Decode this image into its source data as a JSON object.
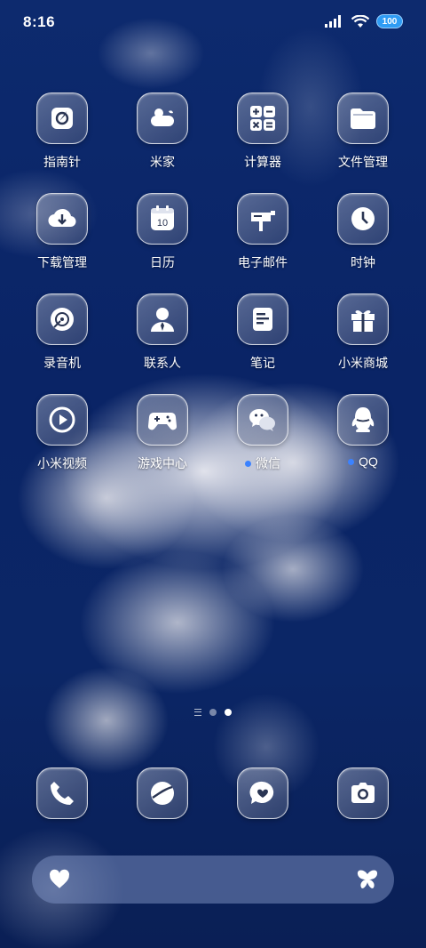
{
  "status": {
    "time": "8:16",
    "battery": "100"
  },
  "apps": [
    {
      "name": "指南针",
      "icon": "compass-icon",
      "dot": false
    },
    {
      "name": "米家",
      "icon": "mijia-icon",
      "dot": false
    },
    {
      "name": "计算器",
      "icon": "calculator-icon",
      "dot": false
    },
    {
      "name": "文件管理",
      "icon": "folder-icon",
      "dot": false
    },
    {
      "name": "下载管理",
      "icon": "download-icon",
      "dot": false
    },
    {
      "name": "日历",
      "icon": "calendar-icon",
      "dot": false,
      "badge": "10"
    },
    {
      "name": "电子邮件",
      "icon": "mailbox-icon",
      "dot": false
    },
    {
      "name": "时钟",
      "icon": "clock-icon",
      "dot": false
    },
    {
      "name": "录音机",
      "icon": "recorder-icon",
      "dot": false
    },
    {
      "name": "联系人",
      "icon": "contacts-icon",
      "dot": false
    },
    {
      "name": "笔记",
      "icon": "notes-icon",
      "dot": false
    },
    {
      "name": "小米商城",
      "icon": "gift-icon",
      "dot": false
    },
    {
      "name": "小米视频",
      "icon": "play-icon",
      "dot": false
    },
    {
      "name": "游戏中心",
      "icon": "gamepad-icon",
      "dot": false
    },
    {
      "name": "微信",
      "icon": "wechat-icon",
      "dot": true
    },
    {
      "name": "QQ",
      "icon": "qq-icon",
      "dot": true
    }
  ],
  "dock": [
    {
      "icon": "phone-icon"
    },
    {
      "icon": "browser-icon"
    },
    {
      "icon": "messages-icon"
    },
    {
      "icon": "camera-icon"
    }
  ],
  "pager": {
    "pages": 2,
    "active": 2
  },
  "bottom_bar": {
    "left_icon": "heart-icon",
    "right_icon": "butterfly-icon"
  },
  "colors": {
    "notify_dot": "#3b82ff",
    "battery": "#2f9cf4"
  }
}
